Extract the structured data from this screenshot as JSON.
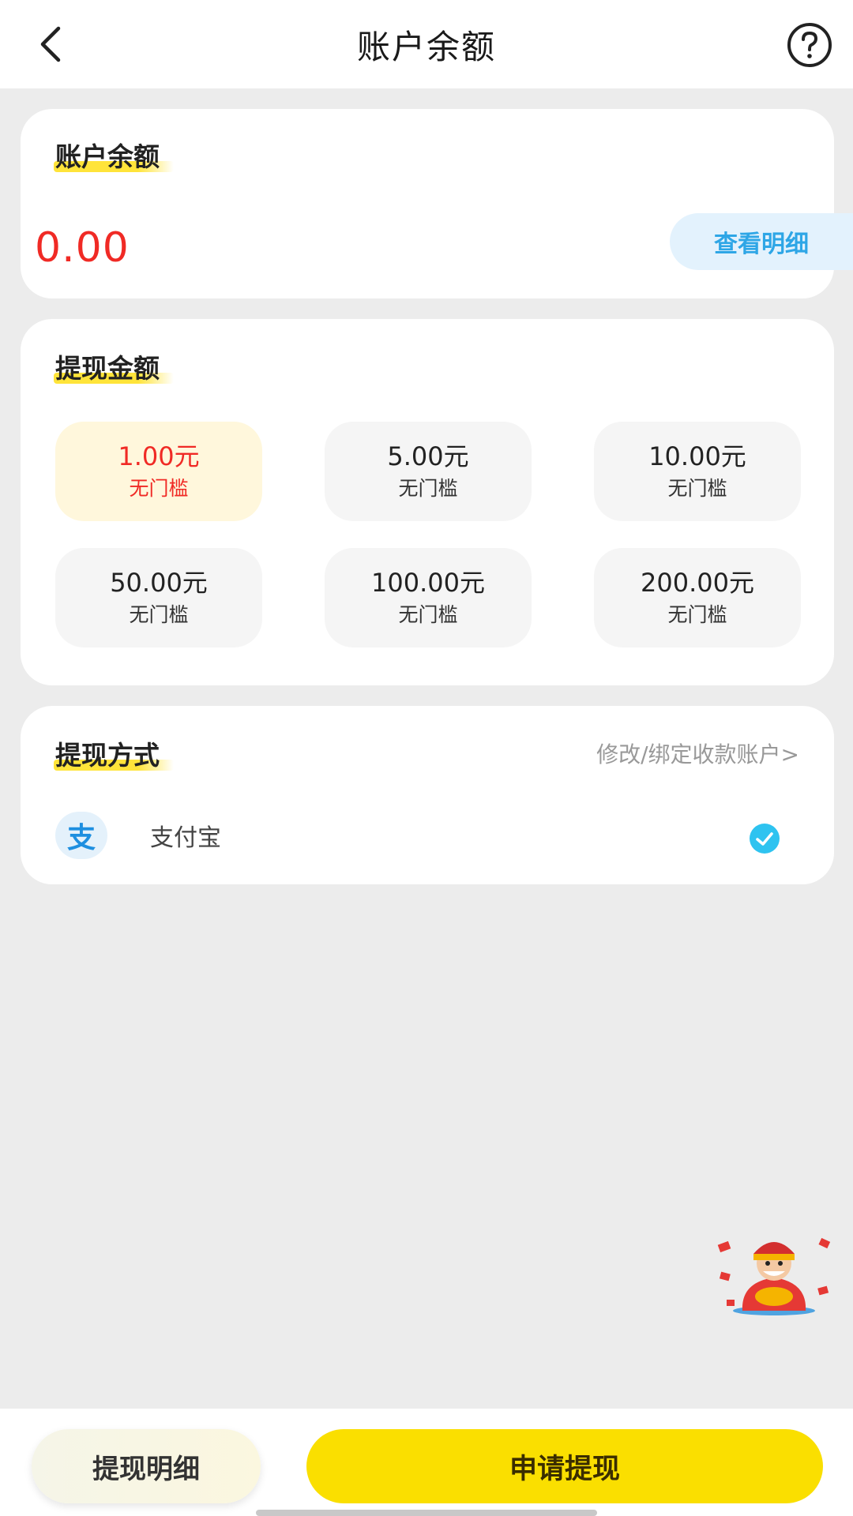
{
  "header": {
    "title": "账户余额",
    "back_icon": "chevron-left-icon",
    "help_icon": "question-circle-icon"
  },
  "balance": {
    "title": "账户余额",
    "value": "0.00",
    "detail_button": "查看明细",
    "value_color": "#f02a25"
  },
  "amount": {
    "title": "提现金额",
    "options": [
      {
        "amount": "1.00元",
        "note": "无门槛",
        "selected": true
      },
      {
        "amount": "5.00元",
        "note": "无门槛",
        "selected": false
      },
      {
        "amount": "10.00元",
        "note": "无门槛",
        "selected": false
      },
      {
        "amount": "50.00元",
        "note": "无门槛",
        "selected": false
      },
      {
        "amount": "100.00元",
        "note": "无门槛",
        "selected": false
      },
      {
        "amount": "200.00元",
        "note": "无门槛",
        "selected": false
      }
    ]
  },
  "method": {
    "title": "提现方式",
    "edit_link": "修改/绑定收款账户>",
    "alipay_label": "支付宝",
    "alipay_icon": "alipay-icon",
    "alipay_icon_glyph": "支",
    "check_icon": "check-circle-icon",
    "check_color": "#2ec3f0"
  },
  "bottom": {
    "history_button": "提现明细",
    "apply_button": "申请提现",
    "accent": "#fadf00"
  },
  "floating": {
    "mascot_icon": "fortune-god-mascot-icon"
  }
}
